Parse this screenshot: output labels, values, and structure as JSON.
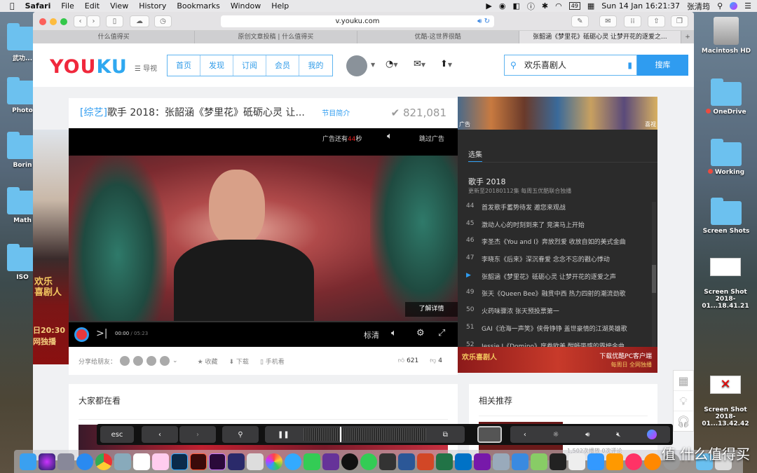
{
  "menubar": {
    "apple": "",
    "app": "Safari",
    "items": [
      "File",
      "Edit",
      "View",
      "History",
      "Bookmarks",
      "Window",
      "Help"
    ],
    "clock": "Sun 14 Jan  16:21:37",
    "user": "张清筠",
    "battery": "49"
  },
  "desktop": {
    "left_items": [
      "武功...",
      "Photo",
      "Borin",
      "Math",
      "ISO"
    ],
    "right_items": [
      {
        "label": "Macintosh HD",
        "type": "drive"
      },
      {
        "label": "OneDrive",
        "type": "folder",
        "tag": "red"
      },
      {
        "label": "Working",
        "type": "folder",
        "tag": "red"
      },
      {
        "label": "Screen Shots",
        "type": "folder"
      },
      {
        "label": "Screen Shot\n2018-01...18.41.21",
        "type": "image"
      },
      {
        "label": "Screen Shot\n2018-01...13.42.42",
        "type": "image"
      }
    ]
  },
  "safari": {
    "url": "v.youku.com",
    "tabs": [
      {
        "label": "什么值得买"
      },
      {
        "label": "原创文章投稿 | 什么值得买"
      },
      {
        "label": "优酷-这世界很酷"
      },
      {
        "label": "张韶涵《梦里花》砥砺心灵 让梦开花的逐爱之...",
        "active": true
      }
    ]
  },
  "youku": {
    "logo": "YOUKU",
    "nav_label": "导视",
    "nav": [
      "首页",
      "发现",
      "订阅",
      "会员",
      "我的"
    ],
    "search": {
      "value": "欢乐喜剧人",
      "button": "搜库"
    },
    "video": {
      "category": "[综艺]",
      "title": "歌手 2018：张韶涵《梦里花》砥砺心灵 让...",
      "intro": "节目简介",
      "views": "821,081",
      "ad_prefix": "广告还有",
      "ad_seconds": "44",
      "ad_suffix": "秒",
      "skip_ad": "跳过广告",
      "learn_more": "了解详情",
      "time_current": "00:00",
      "time_total": "05:23",
      "quality": "标清",
      "progress": 0
    },
    "share": {
      "label": "分享给朋友：",
      "favorite": "收藏",
      "download": "下载",
      "mobile": "手机看",
      "likes": "621",
      "dislikes": "4"
    },
    "episodes": {
      "tab": "选集",
      "show_title": "歌手 2018",
      "show_sub": "更新至20180112集 每周五优酷联合独播",
      "items": [
        {
          "num": "44",
          "title": "首发歌手蓄势待发 邀您来观战"
        },
        {
          "num": "45",
          "title": "激动人心的时刻到来了 竞演马上开始"
        },
        {
          "num": "46",
          "title": "李圣杰《You and I》奔放烈爱 收放自如的美式金曲"
        },
        {
          "num": "47",
          "title": "李晓东《后来》深沉眷爱 念念不忘的戳心悸动"
        },
        {
          "num": "48",
          "title": "张韶涵《梦里花》砥砺心灵 让梦开花的逐爱之声",
          "playing": true
        },
        {
          "num": "49",
          "title": "张天《Queen Bee》融贯中西 热力四射的潮流劲歌"
        },
        {
          "num": "50",
          "title": "火药味骤浓 张天预投票第一"
        },
        {
          "num": "51",
          "title": "GAI《沧海一声笑》侠骨铮铮 盖世豪情的江湖英雄歌"
        },
        {
          "num": "52",
          "title": "Jessie J《Domino》席卷欧美 酣畅带感的霸榜金曲"
        }
      ]
    },
    "strip_labels": [
      "广告",
      "喜视"
    ],
    "ad_banner": {
      "left": "欢乐喜剧人",
      "right": "下载优酷PC客户端",
      "right_sub": "每周日 全网独播"
    },
    "left_ad": {
      "line1": "欢乐",
      "line2": "喜剧人",
      "time": "日20:30",
      "sub": "网独播"
    },
    "sections": {
      "everyone_watching": "大家都在看",
      "related": "相关推荐",
      "related_meta": "1,502次播放 0次评论"
    }
  },
  "touchbar": {
    "esc": "esc"
  },
  "watermark": "值 什么值得买",
  "colors": {
    "accent": "#2f9cf0",
    "ad_seconds": "#e02020",
    "playing": "#2f9cf0"
  }
}
